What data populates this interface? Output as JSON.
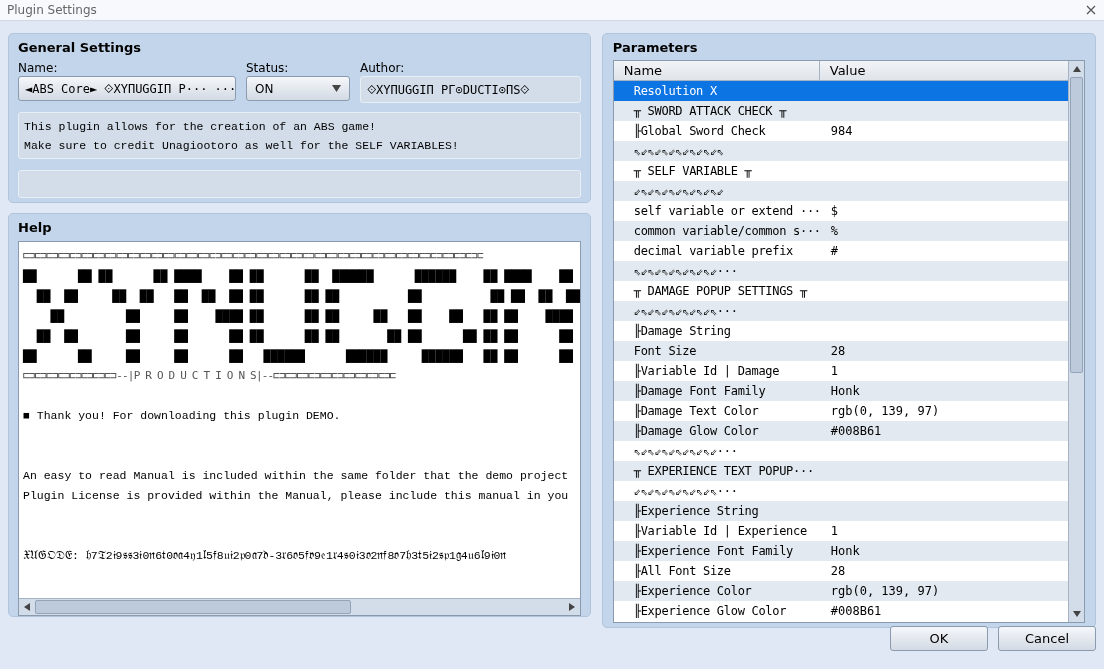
{
  "window": {
    "title": "Plugin Settings"
  },
  "general_settings": {
    "title": "General Settings",
    "name_label": "Name:",
    "name_value": "◄ABS Core► ⟐XYПՍGGIП P··· ···",
    "status_label": "Status:",
    "status_value": "ON",
    "author_label": "Author:",
    "author_value": "⟐XYПՍGGIП PΓ⊙DՍCTI⊙ПS⟐",
    "description": [
      "This plugin allows for the creation of an ABS game!",
      "Make sure to credit Unagiootoro as well for the SELF VARIABLES!"
    ]
  },
  "help": {
    "title": "Help",
    "lines": [
      {
        "kind": "border",
        "text": "⊏⊐⊏⊐⊏⊐⊏⊐⊏⊐⊏⊐⊏⊐⊏⊐⊏⊐⊏⊐⊏⊐⊏⊐⊏⊐⊏⊐⊏⊐⊏⊐⊏⊐⊏⊐⊏⊐⊏⊐⊏⊐⊏⊐⊏⊐⊏⊐⊏⊐⊏⊐⊏⊐⊏⊐⊏⊐⊏⊐⊏⊐⊏⊐⊏⊐⊏⊐⊏⊐⊏⊐⊏⊐⊏⊐⊏⊐⊏"
      },
      {
        "kind": "blocks",
        "text": "██      ██ ██      ██ ████    ██ ██      ██  ██████      ██████    ██ ████    ██"
      },
      {
        "kind": "blocks",
        "text": "  ██  ██     ██  ██   ██  ██  ██ ██      ██ ██          ██          ██ ██  ██  ██"
      },
      {
        "kind": "blocks",
        "text": "    ██         ██     ██    ████ ██      ██ ██     ██   ██    ██   ██ ██    ████"
      },
      {
        "kind": "blocks",
        "text": "  ██  ██       ██     ██      ██ ██      ██ ██       ██ ██      ██ ██ ██      ██"
      },
      {
        "kind": "blocks",
        "text": "██      ██     ██     ██      ██   ██████      ██████     ██████   ██ ██      ██"
      },
      {
        "kind": "border",
        "text": "⊏⊐⊏⊐⊏⊐⊏⊐⊏⊐⊏⊐⊏⊐⊏⊐--|P R O D U C T I O N S|--⊏⊐⊏⊐⊏⊐⊏⊐⊏⊐⊏⊐⊏⊐⊏⊐⊏⊐⊏⊐⊏"
      },
      {
        "kind": "heading",
        "text": "■ Thank you! For downloading this plugin DEMO."
      },
      {
        "kind": "paragraph",
        "text": "An easy to read Manual is included within the same folder that the demo project"
      },
      {
        "kind": "line",
        "text": "Plugin License is provided within the Manual, please include this manual in you"
      },
      {
        "kind": "paragraph",
        "text": "𝔛𝔘𝔊𝔒𝔇𝔈: 𝔥7𝔗2𝔦9𝔰𝔰3𝔦0𝔫6𝔱0𝔬𝔞4𝔶1𝔩5𝔣8𝔲𝔦2𝔭0𝔞7𝔡-3𝔯6𝔬5𝔣𝔳9𝔢1𝔯4𝔰0𝔦3𝔬2𝔫𝔣8𝔬7𝔥3𝔱5𝔦2𝔰𝔭1𝔤4𝔲6𝔩9𝔦0𝔫"
      }
    ]
  },
  "parameters": {
    "title": "Parameters",
    "columns": [
      "Name",
      "Value"
    ],
    "rows": [
      {
        "name": "Resolution X",
        "selected": true
      },
      {
        "name": "╥ SWORD ATTACK CHECK ╥",
        "selected": false
      },
      {
        "name": "╟Global Sword Check",
        "value": "984",
        "selected": false
      },
      {
        "name": "⇖⇙⇖⇙⇖⇙⇖⇙⇖⇙⇖⇙⇖",
        "selected": false
      },
      {
        "name": "╥ SELF VARIABLE ╥",
        "selected": false
      },
      {
        "name": "⇙⇖⇙⇖⇙⇖⇙⇖⇙⇖⇙⇖⇙",
        "selected": false
      },
      {
        "name": "self variable or extend ···",
        "value": "$",
        "selected": false
      },
      {
        "name": "common variable/common s···",
        "value": "%",
        "selected": false
      },
      {
        "name": "decimal variable prefix",
        "value": "#",
        "selected": false
      },
      {
        "name": "⇖⇙⇖⇙⇖⇙⇖⇙⇖⇙⇖⇙···",
        "selected": false
      },
      {
        "name": "╥ DAMAGE POPUP SETTINGS ╥",
        "selected": false
      },
      {
        "name": "⇙⇖⇙⇖⇙⇖⇙⇖⇙⇖⇙⇖···",
        "selected": false
      },
      {
        "name": "╟Damage String",
        "selected": false
      },
      {
        "name": "Font Size",
        "value": "28",
        "selected": false
      },
      {
        "name": "╟Variable Id | Damage",
        "value": "1",
        "selected": false
      },
      {
        "name": "╟Damage Font Family",
        "value": "Honk",
        "selected": false
      },
      {
        "name": "╟Damage Text Color",
        "value": "rgb(0, 139, 97)",
        "selected": false
      },
      {
        "name": "╟Damage Glow Color",
        "value": "#008B61",
        "selected": false
      },
      {
        "name": "⇖⇙⇖⇙⇖⇙⇖⇙⇖⇙⇖⇙···",
        "selected": false
      },
      {
        "name": "╥ EXPERIENCE TEXT POPUP···",
        "selected": false
      },
      {
        "name": "⇙⇖⇙⇖⇙⇖⇙⇖⇙⇖⇙⇖···",
        "selected": false
      },
      {
        "name": "╟Experience String",
        "selected": false
      },
      {
        "name": "╟Variable Id | Experience",
        "value": "1",
        "selected": false
      },
      {
        "name": "╟Experience Font Family",
        "value": "Honk",
        "selected": false
      },
      {
        "name": "╟All Font Size",
        "value": "28",
        "selected": false
      },
      {
        "name": "╟Experience Color",
        "value": "rgb(0, 139, 97)",
        "selected": false
      },
      {
        "name": "╟Experience Glow Color",
        "value": "#008B61",
        "selected": false
      }
    ]
  },
  "buttons": [
    "OK",
    "Cancel"
  ]
}
